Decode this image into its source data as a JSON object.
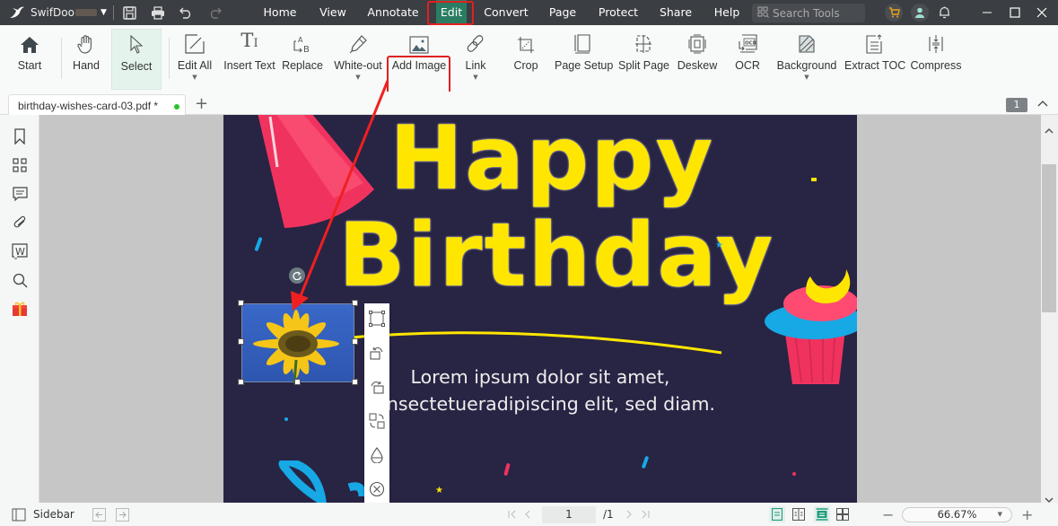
{
  "titlebar": {
    "app_name": "SwifDoo",
    "menu": [
      {
        "label": "Home"
      },
      {
        "label": "View"
      },
      {
        "label": "Annotate"
      },
      {
        "label": "Edit",
        "active": true
      },
      {
        "label": "Convert"
      },
      {
        "label": "Page"
      },
      {
        "label": "Protect"
      },
      {
        "label": "Share"
      },
      {
        "label": "Help"
      }
    ],
    "search_placeholder": "Search Tools"
  },
  "ribbon": {
    "items": [
      {
        "label": "Start",
        "icon": "home-icon"
      },
      {
        "label": "Hand",
        "icon": "hand-icon"
      },
      {
        "label": "Select",
        "icon": "cursor-icon",
        "selected": true
      },
      {
        "label": "Edit All",
        "icon": "edit-all-icon",
        "dropdown": true
      },
      {
        "label": "Insert Text",
        "icon": "insert-text-icon"
      },
      {
        "label": "Replace",
        "icon": "replace-icon"
      },
      {
        "label": "White-out",
        "icon": "white-out-icon",
        "dropdown": true
      },
      {
        "label": "Add Image",
        "icon": "image-icon",
        "highlighted": true
      },
      {
        "label": "Link",
        "icon": "link-icon",
        "dropdown": true
      },
      {
        "label": "Crop",
        "icon": "crop-icon"
      },
      {
        "label": "Page Setup",
        "icon": "page-setup-icon"
      },
      {
        "label": "Split Page",
        "icon": "split-page-icon"
      },
      {
        "label": "Deskew",
        "icon": "deskew-icon"
      },
      {
        "label": "OCR",
        "icon": "ocr-icon"
      },
      {
        "label": "Background",
        "icon": "background-icon",
        "dropdown": true
      },
      {
        "label": "Extract TOC",
        "icon": "extract-toc-icon"
      },
      {
        "label": "Compress",
        "icon": "compress-icon"
      }
    ]
  },
  "tabs": {
    "document": "birthday-wishes-card-03.pdf *",
    "page_badge": "1"
  },
  "document": {
    "line1": "Happy",
    "line2": "Birthday",
    "body1": "Lorem ipsum dolor sit amet,",
    "body2": "consectetueradipiscing elit, sed diam."
  },
  "statusbar": {
    "sidebar_label": "Sidebar",
    "current_page": "1",
    "total_pages": "/1",
    "zoom": "66.67%"
  },
  "colors": {
    "accent": "#2a7d62",
    "highlight": "#e02020",
    "titlebar": "#3b3e42",
    "page_bg": "#282444",
    "heading": "#ffe600"
  }
}
